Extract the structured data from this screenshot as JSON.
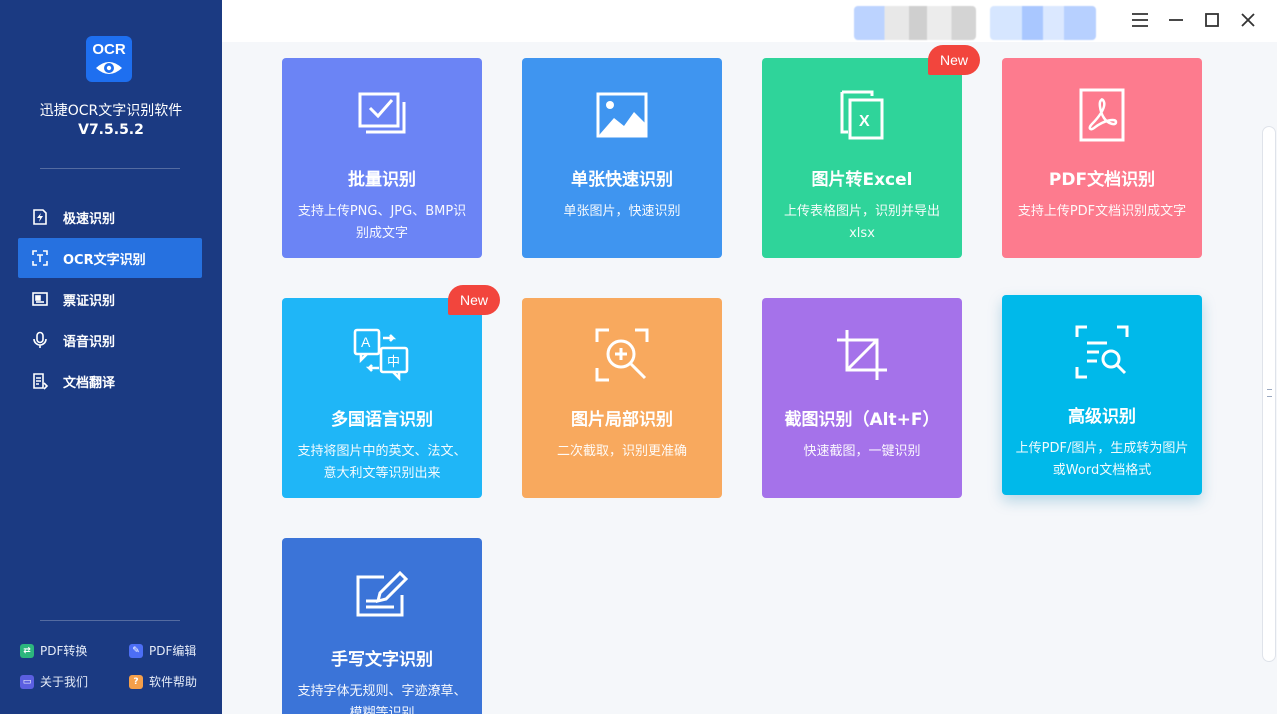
{
  "app": {
    "logo_text": "OCR",
    "name": "迅捷OCR文字识别软件",
    "version": "V7.5.5.2"
  },
  "sidebar": {
    "items": [
      {
        "label": "极速识别",
        "icon": "lightning-doc-icon",
        "active": false
      },
      {
        "label": "OCR文字识别",
        "icon": "scan-frame-icon",
        "active": true
      },
      {
        "label": "票证识别",
        "icon": "id-card-icon",
        "active": false
      },
      {
        "label": "语音识别",
        "icon": "microphone-icon",
        "active": false
      },
      {
        "label": "文档翻译",
        "icon": "translate-doc-icon",
        "active": false
      }
    ],
    "footer": [
      {
        "label": "PDF转换",
        "color": "#2cb67d"
      },
      {
        "label": "PDF编辑",
        "color": "#4c6ef5"
      },
      {
        "label": "关于我们",
        "color": "#5b5fe0"
      },
      {
        "label": "软件帮助",
        "color": "#f59f4a"
      }
    ]
  },
  "cards": [
    {
      "title": "批量识别",
      "desc": "支持上传PNG、JPG、BMP识别成文字",
      "color": "#6b84f5",
      "icon": "batch-check-icon"
    },
    {
      "title": "单张快速识别",
      "desc": "单张图片，快速识别",
      "color": "#3f95f0",
      "icon": "image-icon"
    },
    {
      "title": "图片转Excel",
      "desc": "上传表格图片，识别并导出xlsx",
      "color": "#2fd49a",
      "icon": "excel-icon",
      "badge": "New"
    },
    {
      "title": "PDF文档识别",
      "desc": "支持上传PDF文档识别成文字",
      "color": "#fd7b8e",
      "icon": "pdf-icon"
    },
    {
      "title": "多国语言识别",
      "desc": "支持将图片中的英文、法文、意大利文等识别出来",
      "color": "#1fb6f7",
      "icon": "language-icon",
      "badge": "New",
      "icon_text_a": "A",
      "icon_text_b": "中"
    },
    {
      "title": "图片局部识别",
      "desc": "二次截取，识别更准确",
      "color": "#f8a95e",
      "icon": "zoom-in-icon"
    },
    {
      "title": "截图识别（Alt+F）",
      "desc": "快速截图，一键识别",
      "color": "#a572ea",
      "icon": "crop-icon"
    },
    {
      "title": "高级识别",
      "desc": "上传PDF/图片，生成转为图片或Word文档格式",
      "color": "#00b9ea",
      "icon": "doc-search-icon"
    },
    {
      "title": "手写文字识别",
      "desc": "支持字体无规则、字迹潦草、模糊等识别",
      "color": "#3b74d8",
      "icon": "handwrite-icon"
    }
  ],
  "window": {
    "menu_icon": "hamburger-icon",
    "minimize_icon": "minimize-icon",
    "maximize_icon": "maximize-icon",
    "close_icon": "close-icon"
  }
}
